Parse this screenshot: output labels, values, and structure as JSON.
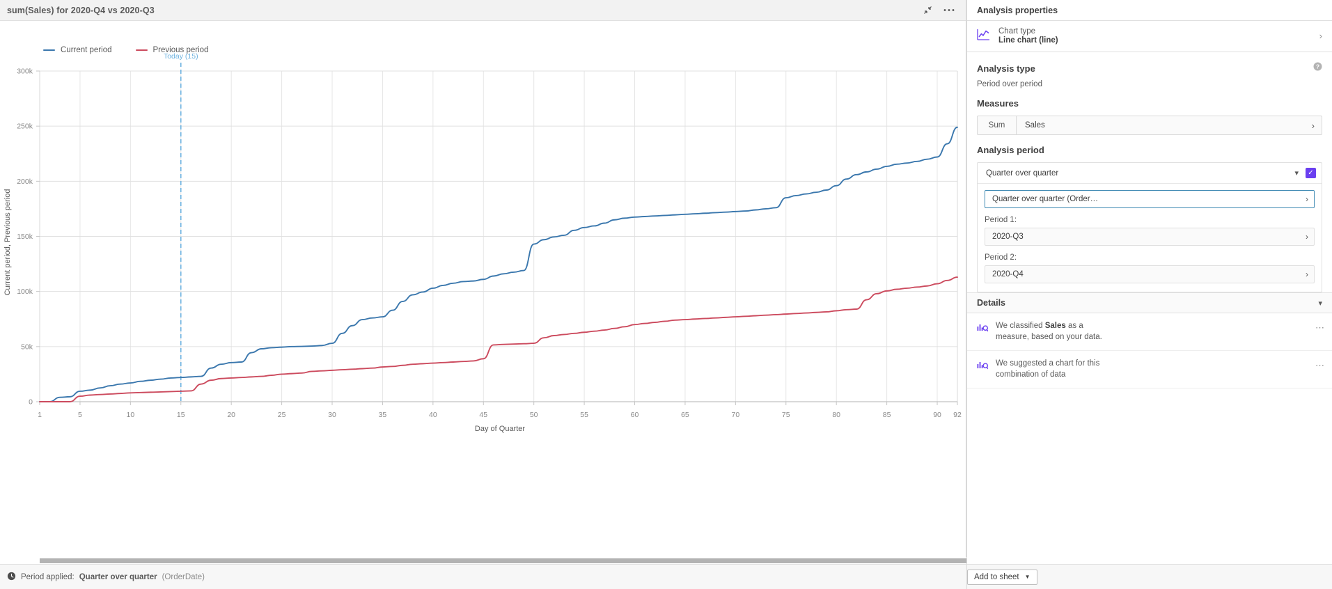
{
  "window": {
    "title": "sum(Sales) for 2020-Q4 vs 2020-Q3",
    "minimize_icon": "collapse-icon",
    "more_icon": "ellipsis-icon"
  },
  "legend": [
    {
      "label": "Current period",
      "color": "#3a77ad"
    },
    {
      "label": "Previous period",
      "color": "#cc4b5e"
    }
  ],
  "annotation": {
    "today_label": "Today (15)",
    "today_x": 15,
    "color": "#6fb3e0"
  },
  "chart_data": {
    "type": "line",
    "title": "sum(Sales) for 2020-Q4 vs 2020-Q3",
    "xlabel": "Day of Quarter",
    "ylabel": "Current period, Previous period",
    "xlim": [
      1,
      92
    ],
    "ylim": [
      0,
      300000
    ],
    "grid": true,
    "legend_position": "top-left",
    "xticks": [
      1,
      5,
      10,
      15,
      20,
      25,
      30,
      35,
      40,
      45,
      50,
      55,
      60,
      65,
      70,
      75,
      80,
      85,
      90,
      92
    ],
    "xticklabels": [
      "1",
      "5",
      "10",
      "15",
      "20",
      "25",
      "30",
      "35",
      "40",
      "45",
      "50",
      "55",
      "60",
      "65",
      "70",
      "75",
      "80",
      "85",
      "90",
      "92"
    ],
    "yticks": [
      0,
      50000,
      100000,
      150000,
      200000,
      250000,
      300000
    ],
    "yticklabels": [
      "0",
      "50k",
      "100k",
      "150k",
      "200k",
      "250k",
      "300k"
    ],
    "x": [
      1,
      2,
      3,
      4,
      5,
      6,
      7,
      8,
      9,
      10,
      11,
      12,
      13,
      14,
      15,
      16,
      17,
      18,
      19,
      20,
      21,
      22,
      23,
      24,
      25,
      26,
      27,
      28,
      29,
      30,
      31,
      32,
      33,
      34,
      35,
      36,
      37,
      38,
      39,
      40,
      41,
      42,
      43,
      44,
      45,
      46,
      47,
      48,
      49,
      50,
      51,
      52,
      53,
      54,
      55,
      56,
      57,
      58,
      59,
      60,
      61,
      62,
      63,
      64,
      65,
      66,
      67,
      68,
      69,
      70,
      71,
      72,
      73,
      74,
      75,
      76,
      77,
      78,
      79,
      80,
      81,
      82,
      83,
      84,
      85,
      86,
      87,
      88,
      89,
      90,
      91,
      92
    ],
    "series": [
      {
        "name": "Current period",
        "color": "#3a77ad",
        "values": [
          0,
          0,
          4000,
          4500,
          9500,
          10500,
          12500,
          14500,
          16000,
          17000,
          18500,
          19500,
          20500,
          21500,
          22000,
          22500,
          23000,
          30500,
          34000,
          35500,
          36000,
          44500,
          48000,
          49000,
          49500,
          50000,
          50200,
          50500,
          51000,
          53000,
          62000,
          69000,
          74500,
          76000,
          77000,
          83000,
          91000,
          97000,
          99500,
          103000,
          105500,
          107500,
          109000,
          109500,
          111000,
          114000,
          116000,
          117500,
          119000,
          143000,
          147000,
          149500,
          151000,
          155500,
          158000,
          159500,
          162000,
          165000,
          166500,
          167500,
          168000,
          168500,
          169000,
          169500,
          170000,
          170500,
          171000,
          171500,
          172000,
          172500,
          173000,
          174000,
          175000,
          176000,
          185000,
          187000,
          188500,
          190000,
          192000,
          196000,
          202000,
          206000,
          208500,
          211000,
          213500,
          215500,
          216500,
          218000,
          220000,
          222000,
          234000,
          249000
        ]
      },
      {
        "name": "Previous period",
        "color": "#cc4b5e",
        "values": [
          0,
          0,
          0,
          0,
          5000,
          6000,
          6500,
          7000,
          7500,
          8000,
          8300,
          8600,
          8900,
          9200,
          9500,
          9800,
          16000,
          19500,
          21000,
          21500,
          22000,
          22500,
          23000,
          24000,
          25000,
          25500,
          26000,
          27500,
          28000,
          28500,
          29000,
          29500,
          30000,
          30500,
          31500,
          32000,
          33000,
          34000,
          34500,
          35000,
          35500,
          36000,
          36500,
          37000,
          39000,
          51500,
          52000,
          52300,
          52600,
          53000,
          58000,
          60000,
          61000,
          62000,
          63000,
          64000,
          65000,
          66500,
          68000,
          70000,
          71000,
          72000,
          73000,
          74000,
          74500,
          75000,
          75500,
          76000,
          76500,
          77000,
          77500,
          78000,
          78500,
          79000,
          79500,
          80000,
          80500,
          81000,
          81500,
          82500,
          83500,
          84000,
          92500,
          98000,
          100500,
          102000,
          103000,
          104000,
          105000,
          107000,
          110000,
          113000
        ]
      }
    ]
  },
  "status_bar": {
    "icon": "clock-icon",
    "label": "Period applied:",
    "value": "Quarter over quarter",
    "source": "(OrderDate)"
  },
  "properties": {
    "header": "Analysis properties",
    "chart_type": {
      "icon": "line-chart-icon",
      "label": "Chart type",
      "value": "Line chart (line)",
      "chevron": "chevron-right-icon"
    },
    "analysis_type": {
      "title": "Analysis type",
      "help_icon": "help-icon",
      "value": "Period over period"
    },
    "measures": {
      "title": "Measures",
      "aggregation": "Sum",
      "field": "Sales",
      "chevron": "chevron-right-icon"
    },
    "analysis_period": {
      "title": "Analysis period",
      "selected": "Quarter over quarter",
      "caret": "chevron-down-icon",
      "checkbox_checked": true,
      "checkbox_color": "#6a3ff0",
      "definition": "Quarter over quarter (Order…",
      "period1_label": "Period 1:",
      "period1_value": "2020-Q3",
      "period2_label": "Period 2:",
      "period2_value": "2020-Q4"
    },
    "details": {
      "title": "Details",
      "collapse_icon": "chevron-down-icon",
      "items": [
        {
          "icon": "insight-icon",
          "text_before": "We classified ",
          "text_bold": "Sales",
          "text_after": " as a measure, based on your data.",
          "more_icon": "ellipsis-icon"
        },
        {
          "icon": "insight-icon",
          "text_before": "We suggested a chart for this combination of data",
          "text_bold": "",
          "text_after": "",
          "more_icon": "ellipsis-icon"
        }
      ]
    },
    "footer": {
      "add_to_sheet": "Add to sheet",
      "caret": "chevron-down-icon"
    }
  }
}
